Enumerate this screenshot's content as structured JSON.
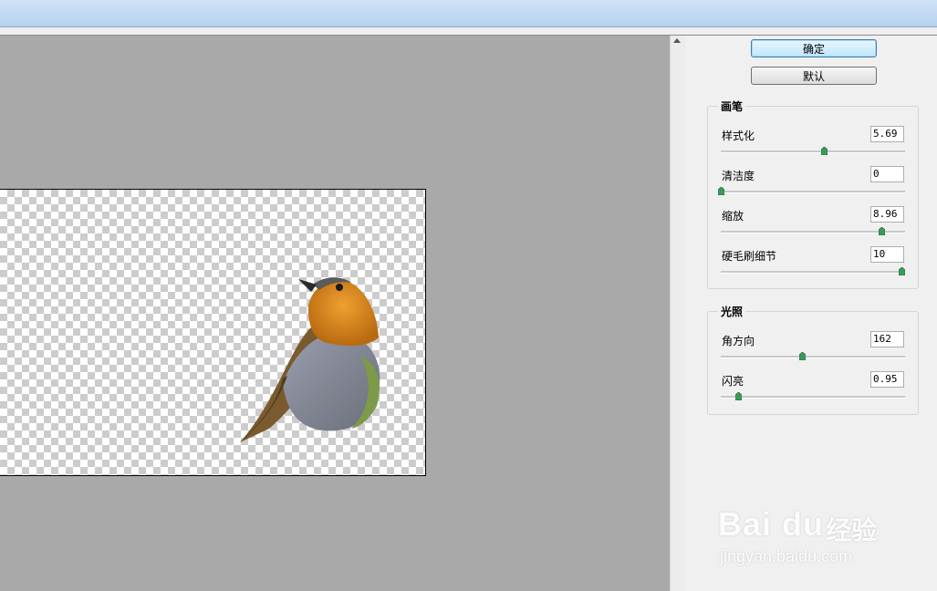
{
  "buttons": {
    "ok": "确定",
    "default": "默认"
  },
  "brush": {
    "title": "画笔",
    "rows": [
      {
        "label": "样式化",
        "value": "5.69",
        "level": 0.57
      },
      {
        "label": "清洁度",
        "value": "0",
        "level": 0.0
      },
      {
        "label": "缩放",
        "value": "8.96",
        "level": 0.89
      },
      {
        "label": "硬毛刷细节",
        "value": "10",
        "level": 1.0
      }
    ]
  },
  "lighting": {
    "title": "光照",
    "rows": [
      {
        "label": "角方向",
        "value": "162",
        "level": 0.45
      },
      {
        "label": "闪亮",
        "value": "0.95",
        "level": 0.095
      }
    ]
  },
  "watermark": {
    "brand": "Bai du",
    "suffix": "经验",
    "url": "jingyan.baidu.com"
  },
  "colors": {
    "accent": "#3c7fb1",
    "canvas_bg": "#a9a9a9",
    "slider_thumb": "#3a9a5a"
  }
}
